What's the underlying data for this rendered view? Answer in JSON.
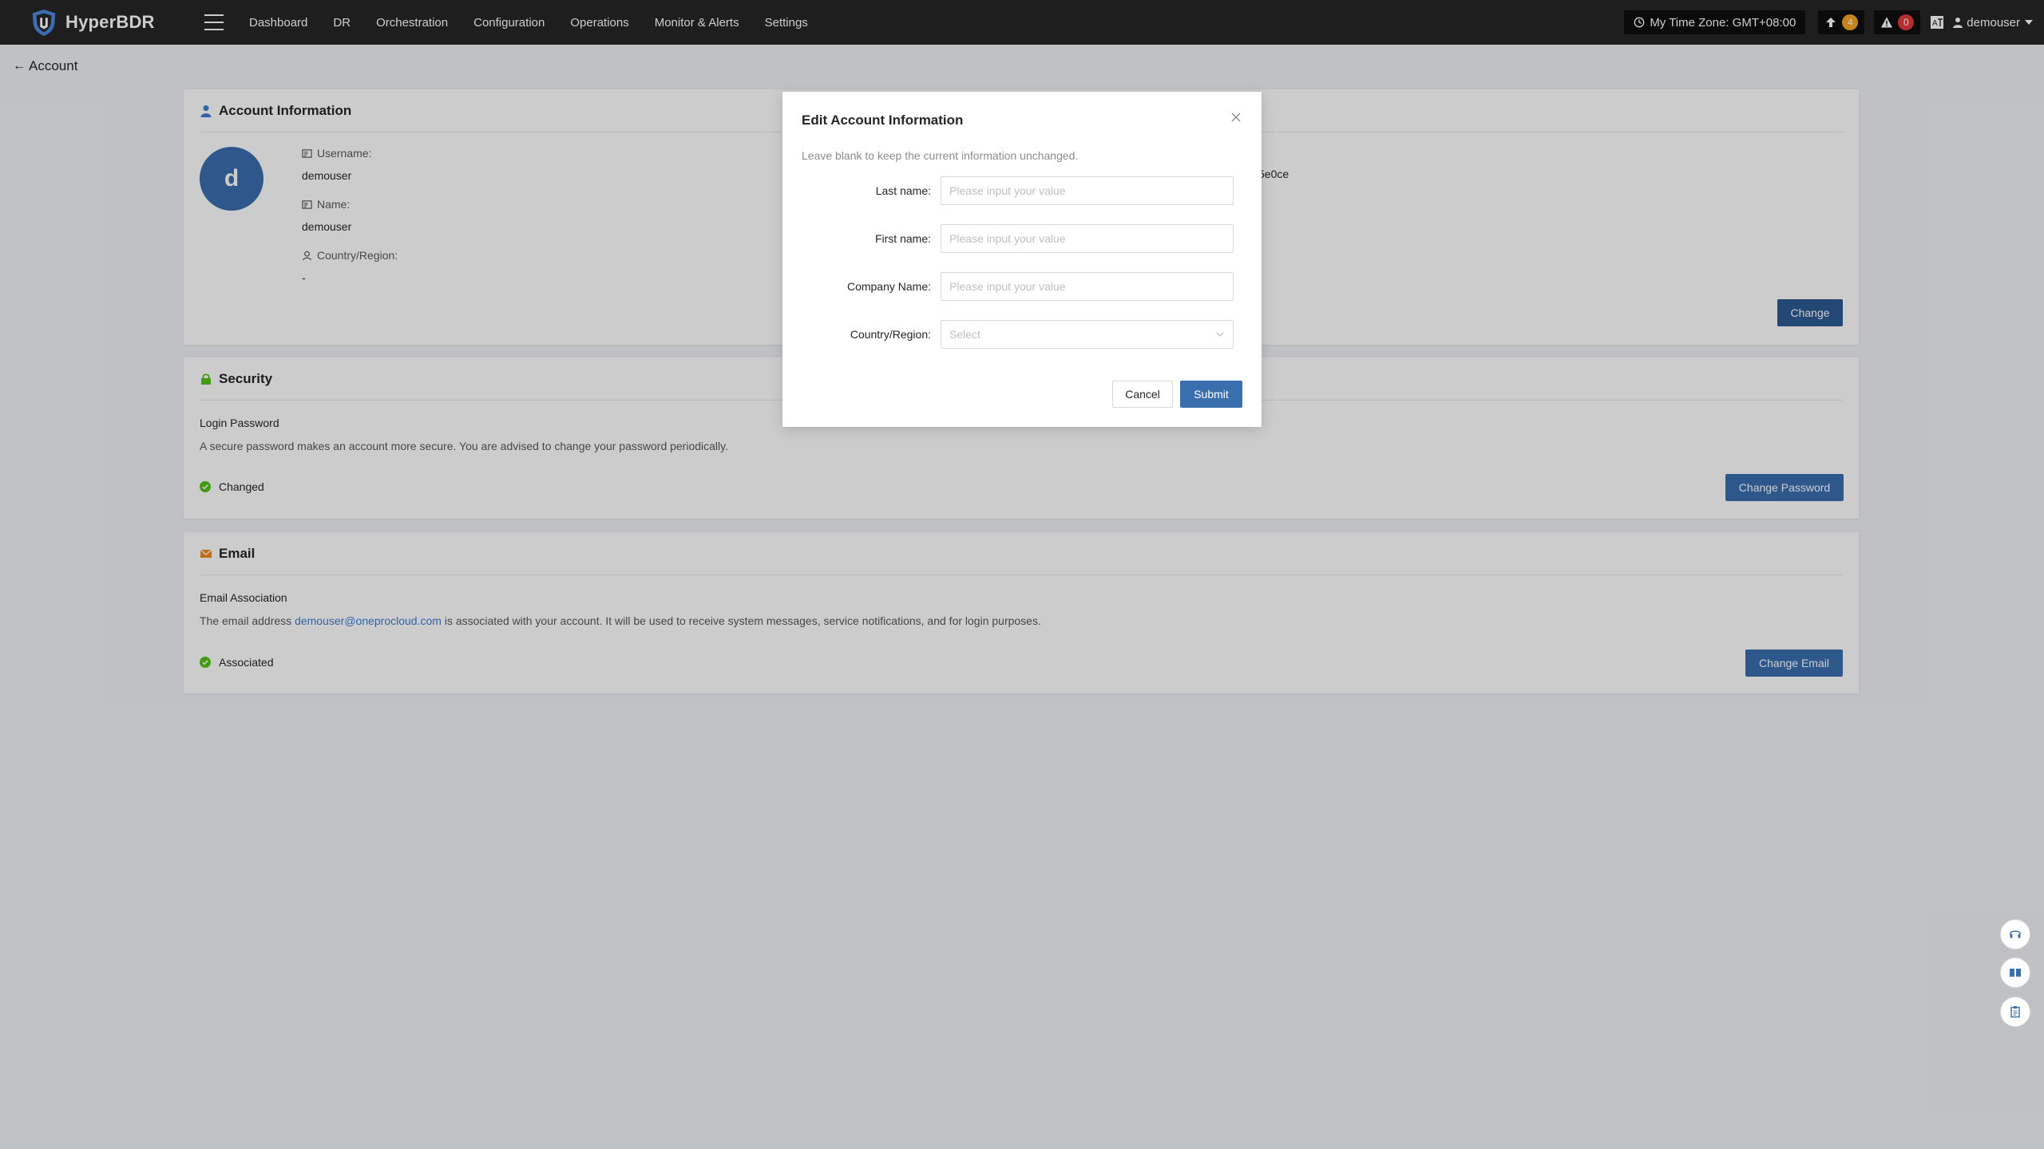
{
  "app": {
    "name": "HyperBDR"
  },
  "nav": {
    "items": [
      "Dashboard",
      "DR",
      "Orchestration",
      "Configuration",
      "Operations",
      "Monitor & Alerts",
      "Settings"
    ]
  },
  "header": {
    "timezone": "My Time Zone: GMT+08:00",
    "upload_count": "4",
    "alert_count": "0",
    "username": "demouser"
  },
  "page": {
    "back_label": "Account"
  },
  "account_info": {
    "title": "Account Information",
    "avatar_letter": "d",
    "username_label": "Username:",
    "username": "demouser",
    "name_label": "Name:",
    "name": "demouser",
    "country_label": "Country/Region:",
    "country": "-",
    "partial_right_text": "5e0ce",
    "change_label": "Change"
  },
  "security": {
    "title": "Security",
    "subtitle": "Login Password",
    "description": "A secure password makes an account more secure. You are advised to change your password periodically.",
    "status": "Changed",
    "button": "Change Password"
  },
  "email": {
    "title": "Email",
    "subtitle": "Email Association",
    "desc_before": "The email address ",
    "address": "demouser@oneprocloud.com",
    "desc_after": " is associated with your account. It will be used to receive system messages, service notifications, and for login purposes.",
    "status": "Associated",
    "button": "Change Email"
  },
  "modal": {
    "title": "Edit Account Information",
    "hint": "Leave blank to keep the current information unchanged.",
    "last_name_label": "Last name:",
    "first_name_label": "First name:",
    "company_label": "Company Name:",
    "country_label": "Country/Region:",
    "placeholder": "Please input your value",
    "select_placeholder": "Select",
    "cancel": "Cancel",
    "submit": "Submit"
  },
  "colors": {
    "primary": "#3a6fae",
    "topbar": "#262626",
    "success": "#52c41a",
    "link": "#3a7fd4"
  }
}
